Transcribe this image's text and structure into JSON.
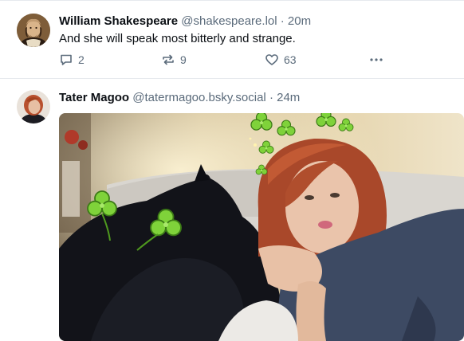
{
  "posts": [
    {
      "author": "William Shakespeare",
      "handle": "@shakespeare.lol",
      "separator": "·",
      "time": "20m",
      "text": "And she will speak most bitterly and strange.",
      "replies": "2",
      "reposts": "9",
      "likes": "63"
    },
    {
      "author": "Tater Magoo",
      "handle": "@tatermagoo.bsky.social",
      "separator": "·",
      "time": "24m"
    }
  ],
  "icons": [
    "reply-icon",
    "repost-icon",
    "like-icon",
    "more-icon"
  ],
  "colors": {
    "icon": "#5b6b7b",
    "divider": "#e6e9ee",
    "name": "#0b0f14"
  }
}
